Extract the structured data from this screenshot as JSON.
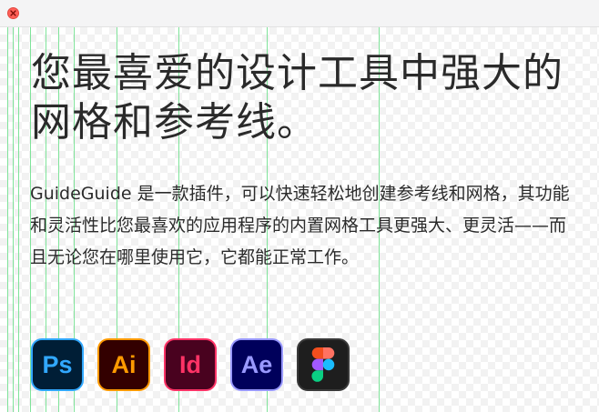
{
  "window": {
    "close_icon": "close-x-icon",
    "close_color": "#ff5f57"
  },
  "headline": "您最喜爱的设计工具中强大的网格和参考线。",
  "description": "GuideGuide 是一款插件，可以快速轻松地创建参考线和网格，其功能和灵活性比您最喜欢的应用程序的内置网格工具更强大、更灵活——而且无论您在哪里使用它，它都能正常工作。",
  "guide_color": "#7fe39a",
  "apps": [
    {
      "name": "Photoshop",
      "label": "Ps",
      "icon": "photoshop-icon",
      "color": "#31a8ff",
      "bg": "#001e36"
    },
    {
      "name": "Illustrator",
      "label": "Ai",
      "icon": "illustrator-icon",
      "color": "#ff9a00",
      "bg": "#330000"
    },
    {
      "name": "InDesign",
      "label": "Id",
      "icon": "indesign-icon",
      "color": "#ff3366",
      "bg": "#49021f"
    },
    {
      "name": "After Effects",
      "label": "Ae",
      "icon": "after-effects-icon",
      "color": "#9999ff",
      "bg": "#00005b"
    },
    {
      "name": "Figma",
      "label": "",
      "icon": "figma-icon",
      "color": "#ffffff",
      "bg": "#1e1e1e"
    }
  ]
}
